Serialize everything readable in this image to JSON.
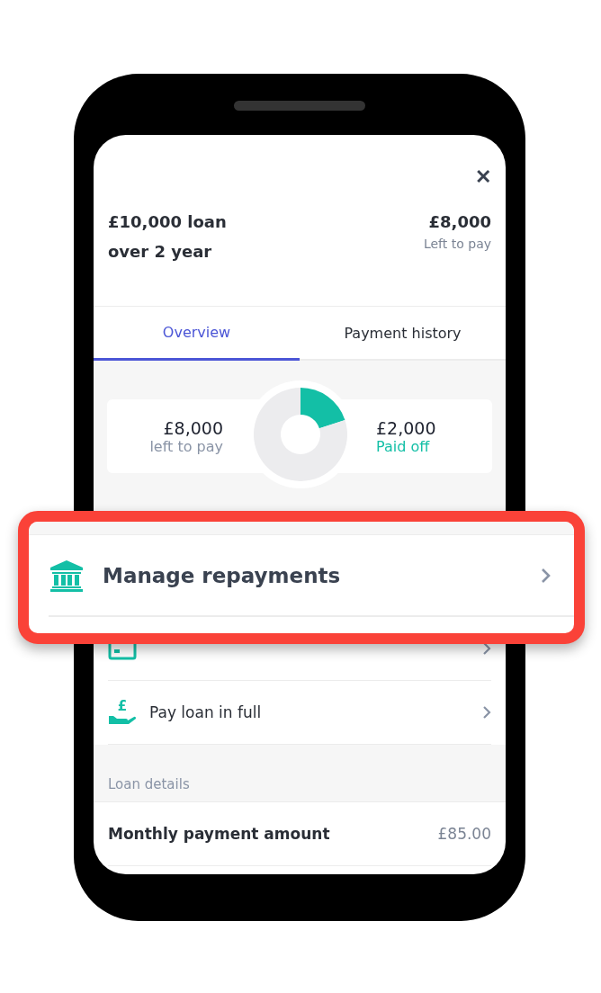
{
  "header": {
    "close": "✕",
    "title_line1": "£10,000 loan",
    "title_line2": "over 2 year",
    "amount": "£8,000",
    "amount_caption": "Left to pay"
  },
  "tabs": [
    {
      "label": "Overview",
      "selected": true
    },
    {
      "label": "Payment history",
      "selected": false
    }
  ],
  "summary": {
    "left_amount": "£8,000",
    "left_caption": "left to pay",
    "paid_amount": "£2,000",
    "paid_caption": "Paid off",
    "chart_data": {
      "type": "donut",
      "values": [
        80,
        20
      ]
    }
  },
  "actions": [
    {
      "kind": "calendar"
    },
    {
      "kind": "pound-hand",
      "glyph": "£",
      "label": "Pay loan in full"
    }
  ],
  "loan_details": {
    "heading": "Loan details",
    "rows": [
      {
        "label": "Monthly payment amount",
        "value": "£85.00"
      }
    ]
  },
  "highlight": {
    "kind": "bank",
    "label": "Manage repayments"
  }
}
